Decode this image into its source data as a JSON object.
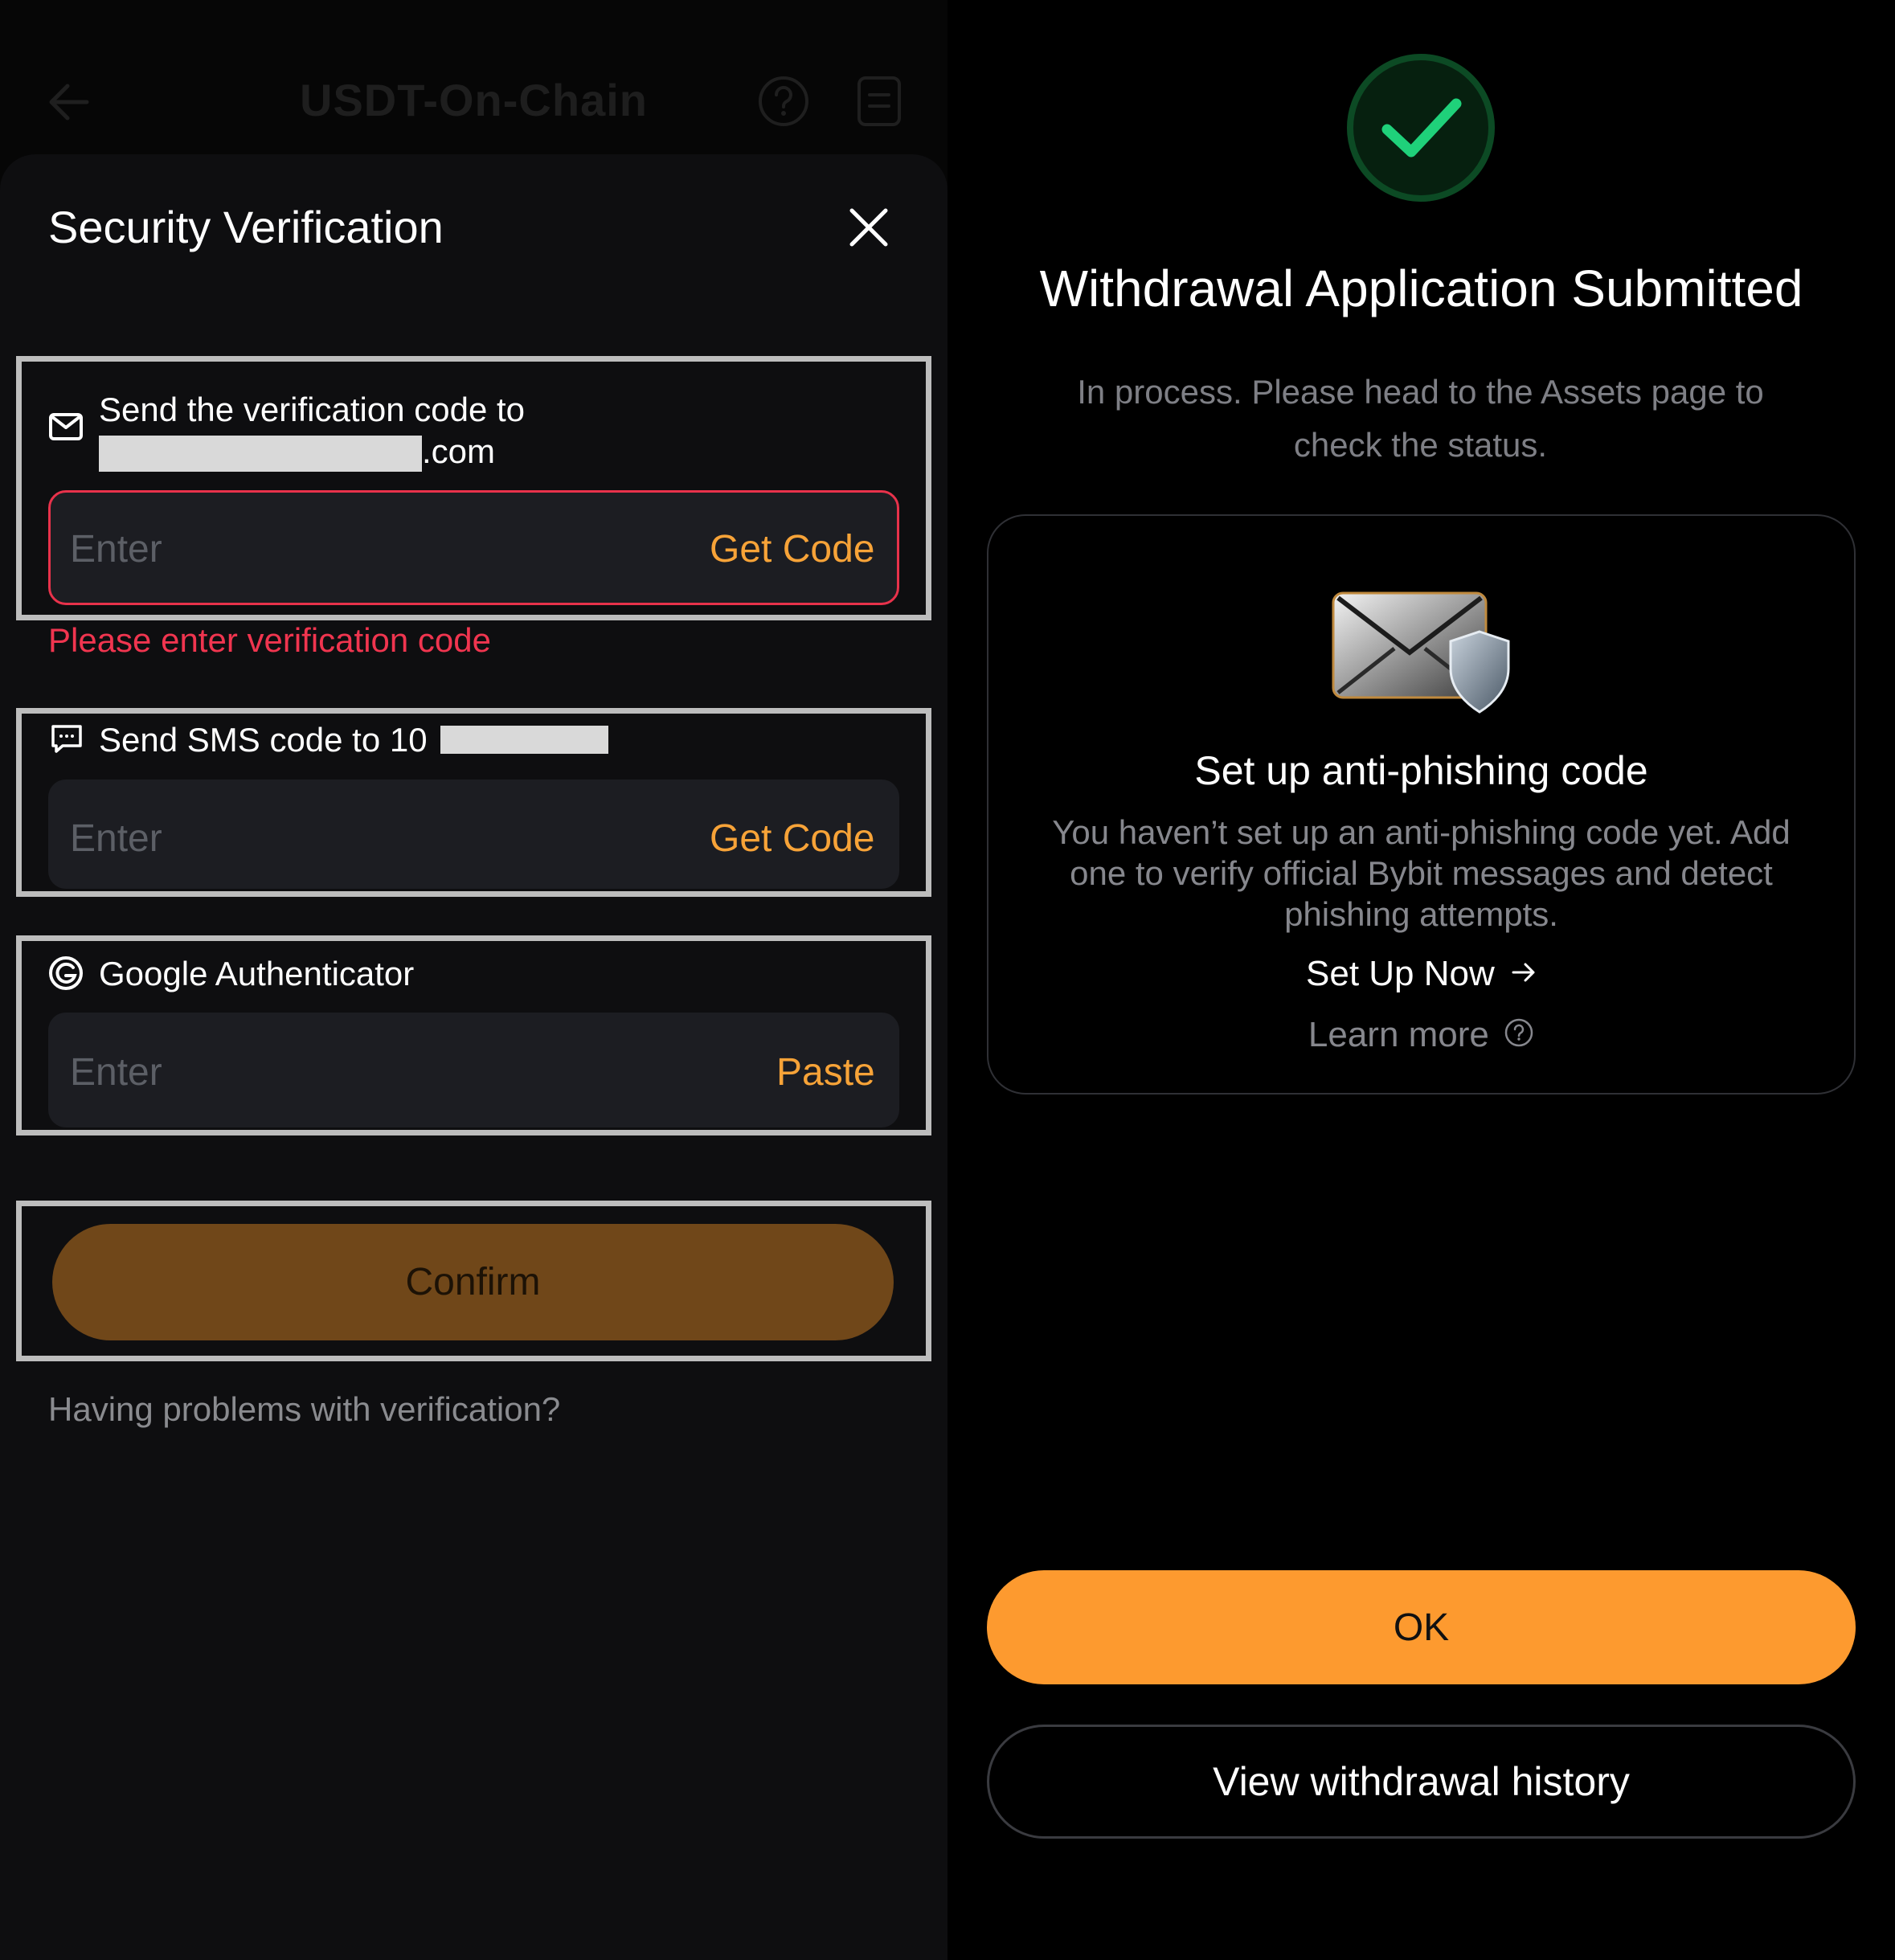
{
  "background_page": {
    "title": "USDT-On-Chain",
    "back_icon": "arrow-left-icon",
    "help_icon": "question-circle-icon",
    "records_icon": "document-icon"
  },
  "verification": {
    "title": "Security Verification",
    "close_icon": "close-icon",
    "email": {
      "icon": "mail-icon",
      "label_line1": "Send the verification code to",
      "label_suffix": ".com",
      "placeholder": "Enter",
      "action": "Get Code",
      "error": "Please enter verification code"
    },
    "sms": {
      "icon": "chat-icon",
      "label": "Send SMS code to 10",
      "placeholder": "Enter",
      "action": "Get Code"
    },
    "google": {
      "icon": "google-icon",
      "label": "Google Authenticator",
      "placeholder": "Enter",
      "action": "Paste"
    },
    "confirm_label": "Confirm",
    "help_text": "Having problems with verification?"
  },
  "result": {
    "status_icon": "checkmark-icon",
    "title": "Withdrawal Application Submitted",
    "subtitle": "In process. Please head to the Assets page to check the status.",
    "card": {
      "image_icon": "mail-shield-icon",
      "title": "Set up anti-phishing code",
      "description": "You haven’t set up an anti-phishing code yet. Add one to verify official Bybit messages and detect phishing attempts.",
      "setup_link": "Set Up Now",
      "learn_link": "Learn more"
    },
    "ok_label": "OK",
    "history_label": "View withdrawal history"
  },
  "colors": {
    "accent": "#fd9a2f",
    "error": "#f0354f",
    "success": "#1fd17a",
    "confirm_disabled": "#704719"
  }
}
